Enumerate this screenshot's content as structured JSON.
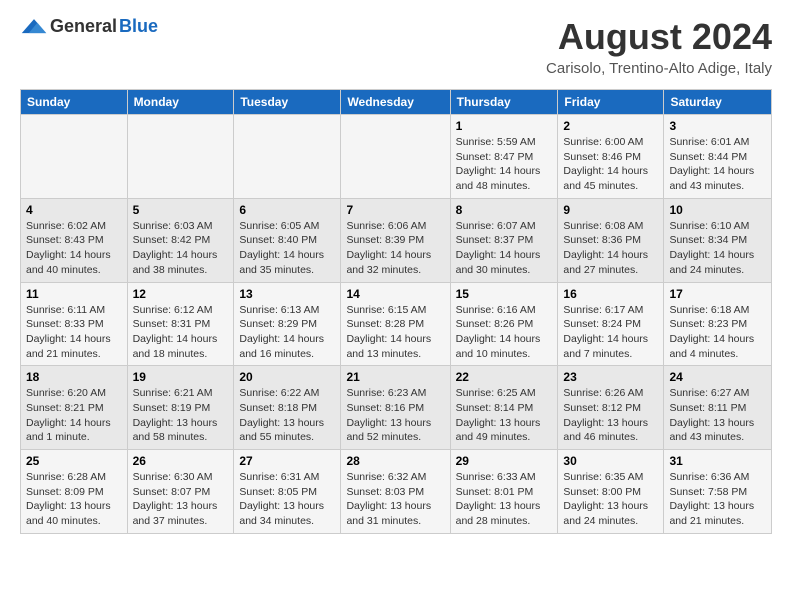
{
  "header": {
    "logo_general": "General",
    "logo_blue": "Blue",
    "month_year": "August 2024",
    "location": "Carisolo, Trentino-Alto Adige, Italy"
  },
  "days_of_week": [
    "Sunday",
    "Monday",
    "Tuesday",
    "Wednesday",
    "Thursday",
    "Friday",
    "Saturday"
  ],
  "weeks": [
    [
      {
        "day": "",
        "info": ""
      },
      {
        "day": "",
        "info": ""
      },
      {
        "day": "",
        "info": ""
      },
      {
        "day": "",
        "info": ""
      },
      {
        "day": "1",
        "info": "Sunrise: 5:59 AM\nSunset: 8:47 PM\nDaylight: 14 hours and 48 minutes."
      },
      {
        "day": "2",
        "info": "Sunrise: 6:00 AM\nSunset: 8:46 PM\nDaylight: 14 hours and 45 minutes."
      },
      {
        "day": "3",
        "info": "Sunrise: 6:01 AM\nSunset: 8:44 PM\nDaylight: 14 hours and 43 minutes."
      }
    ],
    [
      {
        "day": "4",
        "info": "Sunrise: 6:02 AM\nSunset: 8:43 PM\nDaylight: 14 hours and 40 minutes."
      },
      {
        "day": "5",
        "info": "Sunrise: 6:03 AM\nSunset: 8:42 PM\nDaylight: 14 hours and 38 minutes."
      },
      {
        "day": "6",
        "info": "Sunrise: 6:05 AM\nSunset: 8:40 PM\nDaylight: 14 hours and 35 minutes."
      },
      {
        "day": "7",
        "info": "Sunrise: 6:06 AM\nSunset: 8:39 PM\nDaylight: 14 hours and 32 minutes."
      },
      {
        "day": "8",
        "info": "Sunrise: 6:07 AM\nSunset: 8:37 PM\nDaylight: 14 hours and 30 minutes."
      },
      {
        "day": "9",
        "info": "Sunrise: 6:08 AM\nSunset: 8:36 PM\nDaylight: 14 hours and 27 minutes."
      },
      {
        "day": "10",
        "info": "Sunrise: 6:10 AM\nSunset: 8:34 PM\nDaylight: 14 hours and 24 minutes."
      }
    ],
    [
      {
        "day": "11",
        "info": "Sunrise: 6:11 AM\nSunset: 8:33 PM\nDaylight: 14 hours and 21 minutes."
      },
      {
        "day": "12",
        "info": "Sunrise: 6:12 AM\nSunset: 8:31 PM\nDaylight: 14 hours and 18 minutes."
      },
      {
        "day": "13",
        "info": "Sunrise: 6:13 AM\nSunset: 8:29 PM\nDaylight: 14 hours and 16 minutes."
      },
      {
        "day": "14",
        "info": "Sunrise: 6:15 AM\nSunset: 8:28 PM\nDaylight: 14 hours and 13 minutes."
      },
      {
        "day": "15",
        "info": "Sunrise: 6:16 AM\nSunset: 8:26 PM\nDaylight: 14 hours and 10 minutes."
      },
      {
        "day": "16",
        "info": "Sunrise: 6:17 AM\nSunset: 8:24 PM\nDaylight: 14 hours and 7 minutes."
      },
      {
        "day": "17",
        "info": "Sunrise: 6:18 AM\nSunset: 8:23 PM\nDaylight: 14 hours and 4 minutes."
      }
    ],
    [
      {
        "day": "18",
        "info": "Sunrise: 6:20 AM\nSunset: 8:21 PM\nDaylight: 14 hours and 1 minute."
      },
      {
        "day": "19",
        "info": "Sunrise: 6:21 AM\nSunset: 8:19 PM\nDaylight: 13 hours and 58 minutes."
      },
      {
        "day": "20",
        "info": "Sunrise: 6:22 AM\nSunset: 8:18 PM\nDaylight: 13 hours and 55 minutes."
      },
      {
        "day": "21",
        "info": "Sunrise: 6:23 AM\nSunset: 8:16 PM\nDaylight: 13 hours and 52 minutes."
      },
      {
        "day": "22",
        "info": "Sunrise: 6:25 AM\nSunset: 8:14 PM\nDaylight: 13 hours and 49 minutes."
      },
      {
        "day": "23",
        "info": "Sunrise: 6:26 AM\nSunset: 8:12 PM\nDaylight: 13 hours and 46 minutes."
      },
      {
        "day": "24",
        "info": "Sunrise: 6:27 AM\nSunset: 8:11 PM\nDaylight: 13 hours and 43 minutes."
      }
    ],
    [
      {
        "day": "25",
        "info": "Sunrise: 6:28 AM\nSunset: 8:09 PM\nDaylight: 13 hours and 40 minutes."
      },
      {
        "day": "26",
        "info": "Sunrise: 6:30 AM\nSunset: 8:07 PM\nDaylight: 13 hours and 37 minutes."
      },
      {
        "day": "27",
        "info": "Sunrise: 6:31 AM\nSunset: 8:05 PM\nDaylight: 13 hours and 34 minutes."
      },
      {
        "day": "28",
        "info": "Sunrise: 6:32 AM\nSunset: 8:03 PM\nDaylight: 13 hours and 31 minutes."
      },
      {
        "day": "29",
        "info": "Sunrise: 6:33 AM\nSunset: 8:01 PM\nDaylight: 13 hours and 28 minutes."
      },
      {
        "day": "30",
        "info": "Sunrise: 6:35 AM\nSunset: 8:00 PM\nDaylight: 13 hours and 24 minutes."
      },
      {
        "day": "31",
        "info": "Sunrise: 6:36 AM\nSunset: 7:58 PM\nDaylight: 13 hours and 21 minutes."
      }
    ]
  ]
}
